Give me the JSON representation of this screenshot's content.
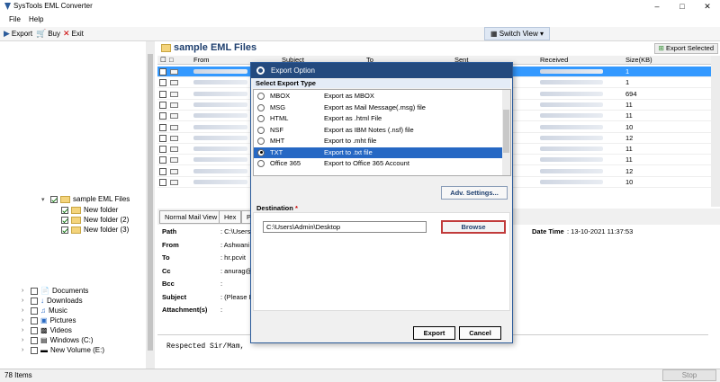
{
  "window": {
    "title": "SysTools EML Converter"
  },
  "menu": [
    "File",
    "Help"
  ],
  "toolbar": {
    "export": "Export",
    "buy": "Buy",
    "exit": "Exit",
    "switch_view": "Switch View"
  },
  "tree": {
    "root": "sample EML Files",
    "folders": [
      "New folder",
      "New folder (2)",
      "New folder (3)"
    ],
    "system": [
      "Documents",
      "Downloads",
      "Music",
      "Pictures",
      "Videos",
      "Windows (C:)",
      "New Volume (E:)"
    ]
  },
  "content": {
    "title": "sample EML Files",
    "export_selected": "Export Selected",
    "columns": [
      "From",
      "Subject",
      "To",
      "Sent",
      "Received",
      "Size(KB)"
    ],
    "sizes": [
      "1",
      "1",
      "694",
      "11",
      "11",
      "10",
      "12",
      "11",
      "11",
      "12",
      "10"
    ]
  },
  "tabs": [
    "Normal Mail View",
    "Hex",
    "P"
  ],
  "details": {
    "labels": [
      "Path",
      "From",
      "To",
      "Cc",
      "Bcc",
      "Subject",
      "Attachment(s)"
    ],
    "values": [
      ": C:\\Users",
      ": Ashwani",
      ": hr.pcvit",
      ": anurag@",
      ":",
      ": (Please Ig",
      ":"
    ],
    "date_label": "Date Time",
    "date_value": ": 13-10-2021 11:37:53"
  },
  "mail_body": "Respected Sir/Mam,",
  "status": {
    "items": "78 Items",
    "stop": "Stop"
  },
  "dialog": {
    "title": "Export Option",
    "section": "Select Export Type",
    "options": [
      {
        "name": "MBOX",
        "desc": "Export as MBOX"
      },
      {
        "name": "MSG",
        "desc": "Export as Mail Message(.msg) file"
      },
      {
        "name": "HTML",
        "desc": "Export as .html File"
      },
      {
        "name": "NSF",
        "desc": "Export as IBM Notes (.nsf) file"
      },
      {
        "name": "MHT",
        "desc": "Export to .mht file"
      },
      {
        "name": "TXT",
        "desc": "Export to .txt file"
      },
      {
        "name": "Office 365",
        "desc": "Export to Office 365 Account"
      }
    ],
    "selected": "TXT",
    "adv_settings": "Adv. Settings...",
    "destination_label": "Destination",
    "destination_required": "*",
    "destination_path": "C:\\Users\\Admin\\Desktop",
    "browse": "Browse",
    "export": "Export",
    "cancel": "Cancel"
  },
  "colors": {
    "title_bar": "#244a7e",
    "selection": "#2668c4",
    "browse_border": "#c13b3b"
  }
}
